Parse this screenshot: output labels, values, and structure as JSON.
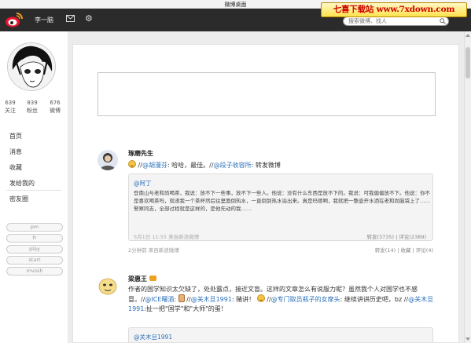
{
  "window": {
    "title": "微博桌面"
  },
  "watermark": {
    "text": "七喜下载站 www.7xdown.com"
  },
  "nav": {
    "user_name": "李一脑",
    "search_placeholder": "搜索微博、找人"
  },
  "profile": {
    "stats": [
      {
        "count": "639",
        "label": "关注"
      },
      {
        "count": "839",
        "label": "粉丝"
      },
      {
        "count": "676",
        "label": "微博"
      }
    ]
  },
  "sidebar": {
    "menu": [
      "首页",
      "消息",
      "收藏",
      "发给我的"
    ],
    "circle": "密友圈",
    "tags": [
      "pm",
      "fr",
      "play",
      "start",
      "mvssh"
    ]
  },
  "composer": {
    "placeholder": ""
  },
  "posts": [
    {
      "author": "琢磨先生",
      "text_parts": [
        "//",
        "@胡漫芬",
        ": 哈哈，最佳。//",
        "@段子收容所",
        ": 转发微博"
      ],
      "quote": {
        "author": "@阿丁",
        "text": "登南山与老和尚喝茶，我说：放不下一些事，放不下一些人。他说：没有什么东西是放不下的。我说：可我偏偏放不下。他说：你不是喜欢喝茶吗，就递我一个茶杯然后往里面倒热水，一直倒到热水溢出来。真是玛德啊，我就把一整壶开水洒在老和尚脑袋上了……警察同志，全部过程就是这样的，是他先动的我……",
        "time": "5月1日 11:55  来自新浪微博",
        "stats": "转发(3735) | 评论(2389)"
      },
      "foot_left": "2分钟前  来自新浪微博",
      "foot_right": "转发(14) | 收藏 | 评论(4)"
    },
    {
      "author": "梁惠王",
      "text_parts": [
        "作者的国学知识太欠缺了，处处露点，接近文盲。这样的文章怎么有说服力呢？虽然我个人对国学也不感冒。//",
        "@ICE曙酒",
        ":",
        " //",
        "@关木旦1991",
        ": 赌讲！",
        " //",
        "@专门取员瓶子的女摩头",
        ": 继续讲讲历史吧，bz //",
        "@关木旦1991",
        ":扯一把\"国学\"和\"大师\"的蛋！"
      ],
      "quote": {
        "author": "@关木旦1991"
      }
    }
  ]
}
